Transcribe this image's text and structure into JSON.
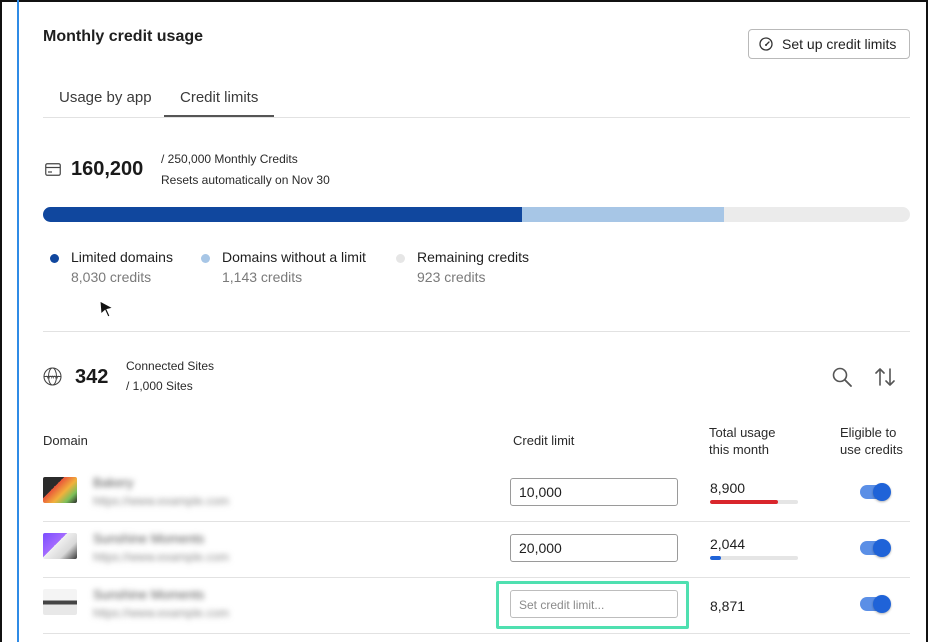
{
  "header": {
    "title": "Monthly credit usage",
    "setup_button_label": "Set up credit limits"
  },
  "tabs": [
    {
      "label": "Usage by app",
      "active": false
    },
    {
      "label": "Credit limits",
      "active": true
    }
  ],
  "credits": {
    "used": "160,200",
    "total_text": "/ 250,000 Monthly Credits",
    "reset_text": "Resets automatically on Nov 30",
    "progress": {
      "limited_fraction": 0.553,
      "no_limit_fraction": 0.232
    }
  },
  "legend": [
    {
      "label": "Limited domains",
      "value": "8,030 credits",
      "color": "#10479e"
    },
    {
      "label": "Domains without a limit",
      "value": "1,143 credits",
      "color": "#a7c6e6"
    },
    {
      "label": "Remaining credits",
      "value": "923 credits",
      "color": "#e6e6e6"
    }
  ],
  "sites": {
    "count": "342",
    "label": "Connected Sites",
    "total_text": "/ 1,000 Sites"
  },
  "table": {
    "headers": {
      "domain": "Domain",
      "credit_limit": "Credit limit",
      "total_usage_line1": "Total usage",
      "total_usage_line2": "this month",
      "eligible_line1": "Eligible to",
      "eligible_line2": "use credits"
    },
    "rows": [
      {
        "name": "Bakery",
        "url": "https://www.example.com",
        "credit_limit": "10,000",
        "placeholder": "",
        "usage": "8,900",
        "usage_fraction": 0.77,
        "usage_color": "#d9262c",
        "eligible": true
      },
      {
        "name": "Sunshine Moments",
        "url": "https://www.example.com",
        "credit_limit": "20,000",
        "placeholder": "",
        "usage": "2,044",
        "usage_fraction": 0.12,
        "usage_color": "#1f63d8",
        "eligible": true
      },
      {
        "name": "Sunshine Moments",
        "url": "https://www.example.com",
        "credit_limit": "",
        "placeholder": "Set credit limit...",
        "usage": "8,871",
        "usage_fraction": 0,
        "usage_color": "#1f63d8",
        "eligible": true
      }
    ]
  },
  "icons": {
    "setup": "gauge-icon",
    "card": "credit-card-icon",
    "globe": "globe-icon",
    "search": "search-icon",
    "sort": "sort-icon",
    "cursor": "mouse-cursor-icon"
  },
  "colors": {
    "accent_blue": "#1f63d8",
    "limited": "#10479e",
    "no_limit": "#a7c6e6",
    "highlight": "#4fe0b0"
  }
}
